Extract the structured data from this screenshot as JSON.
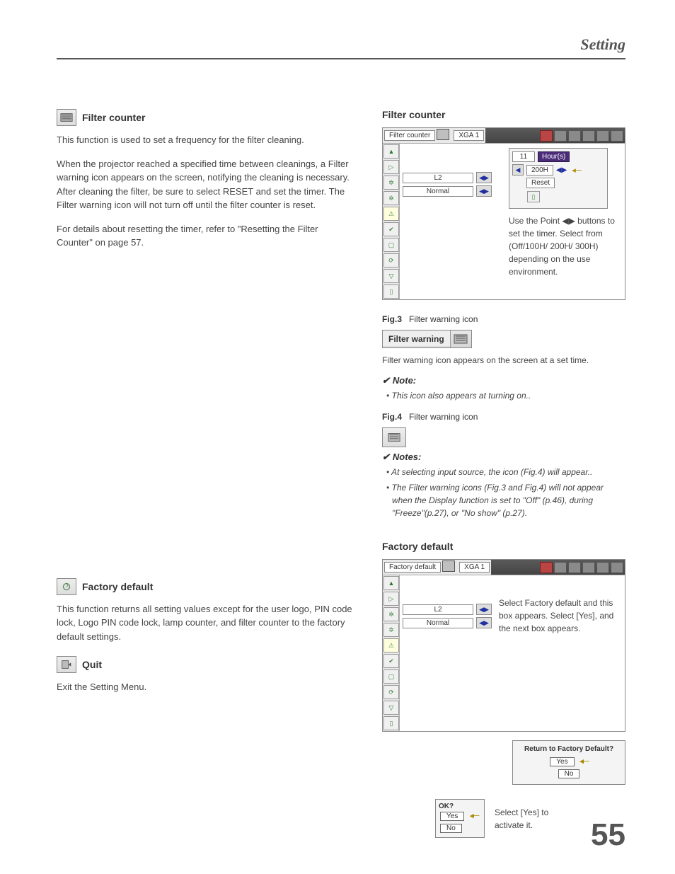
{
  "header": {
    "title": "Setting"
  },
  "left": {
    "filter": {
      "title": "Filter counter",
      "p1": "This function is used to set a frequency for the filter cleaning.",
      "p2": "When the projector reached a specified time between cleanings, a Filter warning icon appears on the screen, notifying the cleaning is necessary. After cleaning the filter, be sure to select RESET and set the timer. The Filter warning icon will not turn off until the filter counter is reset.",
      "p3": "For details about resetting the timer, refer to \"Resetting the Filter Counter\" on page 57."
    },
    "factory": {
      "title": "Factory default",
      "p1": "This function returns all setting values except for the user logo, PIN code lock, Logo PIN code lock, lamp counter, and filter counter to the factory default settings."
    },
    "quit": {
      "title": "Quit",
      "p1": "Exit the Setting Menu."
    }
  },
  "right": {
    "filter_heading": "Filter counter",
    "osd1": {
      "title_label": "Filter counter",
      "mode_label": "XGA 1",
      "row1": "L2",
      "row2": "Normal",
      "value_num": "11",
      "hours": "Hour(s)",
      "value_200h": "200H",
      "reset": "Reset"
    },
    "caption1": "Use the Point ◀▶ buttons to set the timer. Select from (Off/100H/ 200H/ 300H) depending on the use environment.",
    "fig3_label": "Fig.3",
    "fig3_text": "Filter warning icon",
    "filter_warning_label": "Filter warning",
    "caption2": "Filter warning icon appears on the screen at a set time.",
    "note1_head": "Note:",
    "note1_item": "• This icon also appears at turning on..",
    "fig4_label": "Fig.4",
    "fig4_text": "Filter warning icon",
    "notes2_head": "Notes:",
    "notes2_item1": "• At selecting input source, the icon (Fig.4) will appear..",
    "notes2_item2": "• The Filter warning icons (Fig.3 and Fig.4) will not appear when the Display function is set to \"Off\" (p.46), during \"Freeze\"(p.27), or \"No show\" (p.27).",
    "factory_heading": "Factory default",
    "osd2": {
      "title_label": "Factory default",
      "mode_label": "XGA 1",
      "row1": "L2",
      "row2": "Normal"
    },
    "caption3": "Select Factory default and this box appears. Select [Yes], and the next box appears.",
    "dialog1_title": "Return to Factory Default?",
    "dialog_yes": "Yes",
    "dialog_no": "No",
    "dialog2_title": "OK?",
    "caption4": "Select [Yes] to activate it."
  },
  "pagenum": "55"
}
